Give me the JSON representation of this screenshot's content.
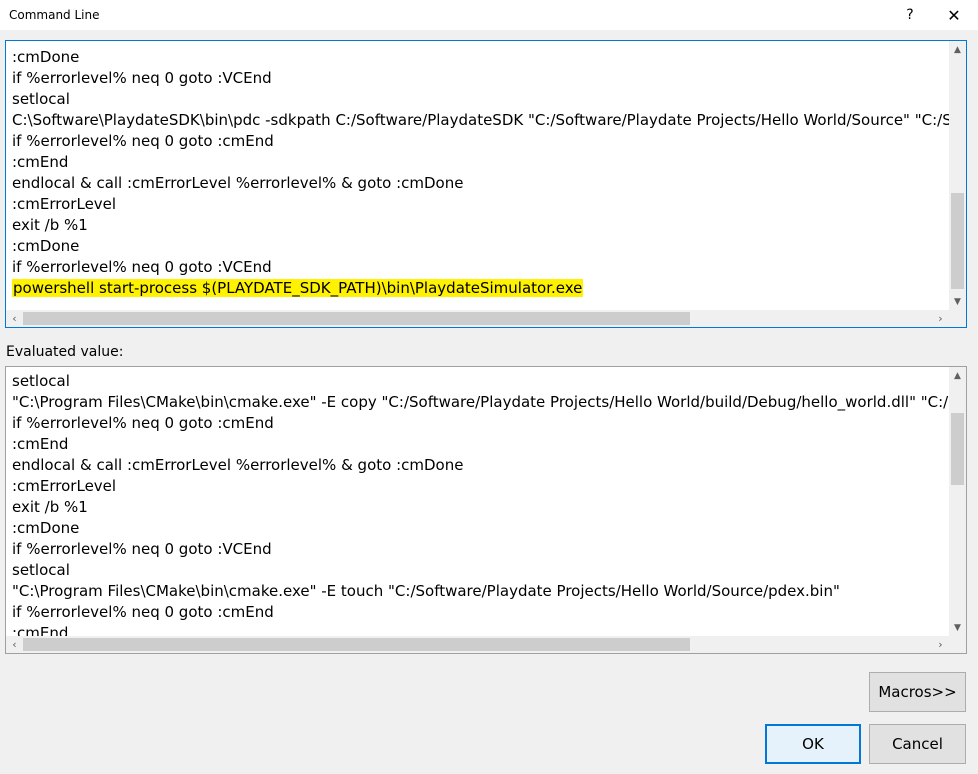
{
  "window": {
    "title": "Command Line",
    "help_glyph": "?",
    "close_glyph": "✕"
  },
  "command_editor": {
    "lines": [
      ":cmDone",
      "if %errorlevel% neq 0 goto :VCEnd",
      "setlocal",
      "C:\\Software\\PlaydateSDK\\bin\\pdc -sdkpath C:/Software/PlaydateSDK \"C:/Software/Playdate Projects/Hello World/Source\" \"C:/Software",
      "if %errorlevel% neq 0 goto :cmEnd",
      ":cmEnd",
      "endlocal & call :cmErrorLevel %errorlevel% & goto :cmDone",
      ":cmErrorLevel",
      "exit /b %1",
      ":cmDone",
      "if %errorlevel% neq 0 goto :VCEnd",
      "powershell start-process $(PLAYDATE_SDK_PATH)\\bin\\PlaydateSimulator.exe"
    ],
    "highlighted_line_index": 11,
    "highlight_color": "#fff200"
  },
  "evaluated": {
    "label": "Evaluated value:",
    "lines": [
      "setlocal",
      "\"C:\\Program Files\\CMake\\bin\\cmake.exe\" -E copy \"C:/Software/Playdate Projects/Hello World/build/Debug/hello_world.dll\" \"C:/Softwar",
      "if %errorlevel% neq 0 goto :cmEnd",
      ":cmEnd",
      "endlocal & call :cmErrorLevel %errorlevel% & goto :cmDone",
      ":cmErrorLevel",
      "exit /b %1",
      ":cmDone",
      "if %errorlevel% neq 0 goto :VCEnd",
      "setlocal",
      "\"C:\\Program Files\\CMake\\bin\\cmake.exe\" -E touch \"C:/Software/Playdate Projects/Hello World/Source/pdex.bin\"",
      "if %errorlevel% neq 0 goto :cmEnd",
      ":cmEnd"
    ]
  },
  "buttons": {
    "macros": "Macros>>",
    "ok": "OK",
    "cancel": "Cancel"
  },
  "colors": {
    "accent": "#0078d7",
    "dialog_bg": "#f0f0f0"
  }
}
